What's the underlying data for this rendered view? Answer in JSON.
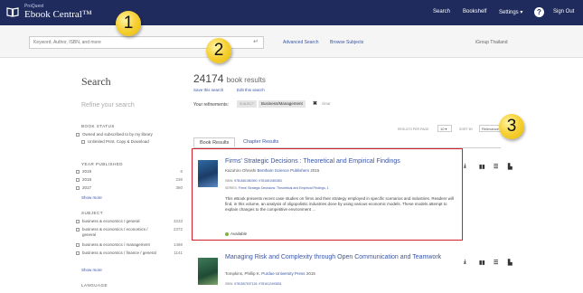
{
  "header": {
    "brand_small": "ProQuest",
    "brand": "Ebook Central™",
    "nav": [
      "Search",
      "Bookshelf",
      "Settings ▾",
      "Sign Out"
    ],
    "help": "?"
  },
  "search": {
    "placeholder": "Keyword, Author, ISBN, and more",
    "advanced": "Advanced Search",
    "browse": "Browse Subjects",
    "group": "iGroup Thailand"
  },
  "sidebar": {
    "title": "Search",
    "refine": "Refine your search",
    "book_status": {
      "heading": "Book Status",
      "items": [
        {
          "label": "Owned and subscribed to by my library"
        },
        {
          "label": "Unlimited Print, Copy & Download"
        }
      ]
    },
    "year": {
      "heading": "Year Published",
      "items": [
        {
          "label": "2019",
          "count": "6"
        },
        {
          "label": "2018",
          "count": "236"
        },
        {
          "label": "2017",
          "count": "380"
        }
      ],
      "more": "Show more"
    },
    "subject": {
      "heading": "Subject",
      "items": [
        {
          "label": "business & economics / general",
          "count": "3233"
        },
        {
          "label": "business & economics / economics / general",
          "count": "2372"
        },
        {
          "label": "business & economics / management",
          "count": "1466"
        },
        {
          "label": "business & economics / finance / general",
          "count": "1141"
        }
      ],
      "more": "Show more"
    },
    "language": {
      "heading": "Language"
    }
  },
  "main": {
    "count": "24174",
    "count_label": "book results",
    "save_search": "Save this search",
    "edit_search": "Edit this search",
    "refinements_label": "Your refinements:",
    "chip_faded": "SUBJECT",
    "chip": "Business/Management",
    "chip_x": "✖",
    "clear": "clear",
    "per_page_label": "RESULTS PER PAGE",
    "per_page": "10 ▾",
    "sort_label": "SORT BY",
    "sort": "Relevance",
    "tabs": [
      "Book Results",
      "Chapter Results"
    ],
    "results": [
      {
        "title": "Firms' Strategic Decisions : Theoretical and Empirical Findings",
        "author": "Kazuhiro Ohnishi",
        "publisher": "Bentham Science Publishers",
        "year": "2015",
        "isbn_label": "ISBN:",
        "isbn": "9781681080390, 9781681080383",
        "series_label": "SERIES:",
        "series": "Firms' Strategic Decisions: Theoretical and Empirical Findings, 1",
        "description": "This eBook presents recent case studies on firms and their strategy employed in specific scenarios and industries. Readers will find, in this volume, an analysis of oligopolistic industries done by using various economic models. These models attempt to explain changes to the competitive environment ...",
        "availability": "Available"
      },
      {
        "title": "Managing Risk and Complexity through Open Communication and Teamwork",
        "author": "Tompkins, Phillip K.",
        "publisher": "Purdue University Press",
        "year": "2015",
        "isbn_label": "ISBN:",
        "isbn": "9781557537126, 9781612493831"
      }
    ],
    "actions": [
      "⤓",
      "▮▮",
      "☰",
      "▙"
    ]
  },
  "callouts": [
    "1",
    "2",
    "3"
  ]
}
